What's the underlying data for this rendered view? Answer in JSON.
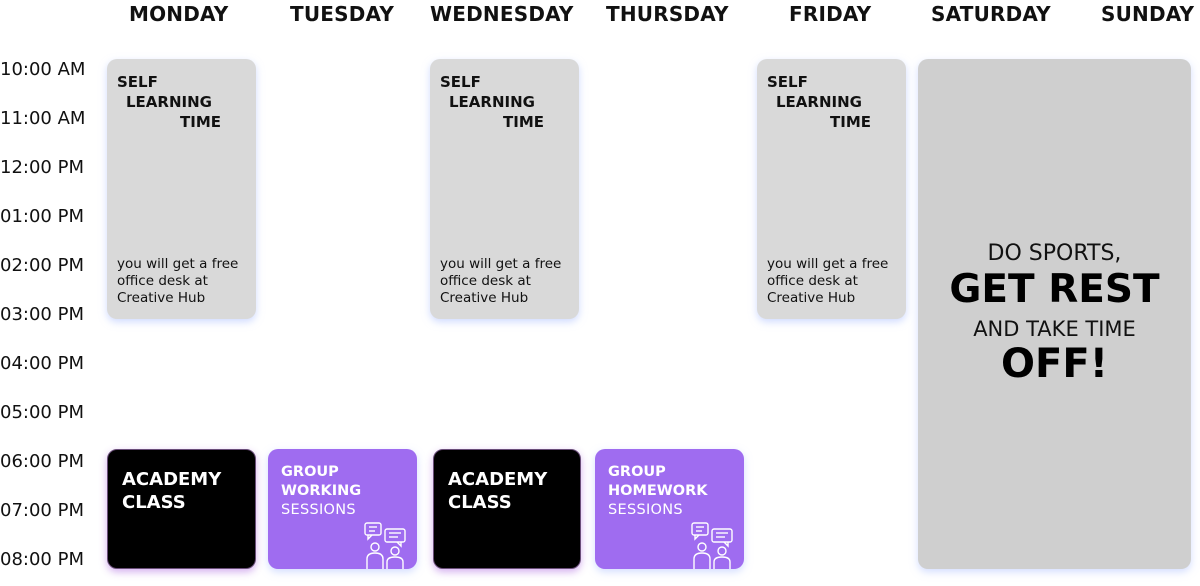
{
  "days": [
    "MONDAY",
    "TUESDAY",
    "WEDNESDAY",
    "THURSDAY",
    "FRIDAY",
    "SATURDAY",
    "SUNDAY"
  ],
  "times": [
    "10:00 AM",
    "11:00 AM",
    "12:00 PM",
    "01:00 PM",
    "02:00 PM",
    "03:00 PM",
    "04:00 PM",
    "05:00 PM",
    "06:00 PM",
    "07:00 PM",
    "08:00 PM"
  ],
  "self_learning": {
    "line1": "SELF",
    "line2": "LEARNING",
    "line3": "TIME",
    "note": "you will get a free office desk at Creative Hub"
  },
  "academy": {
    "line1": "ACADEMY",
    "line2": "CLASS"
  },
  "group_working": {
    "line1": "GROUP",
    "line2": "WORKING",
    "line3": "SESSIONS"
  },
  "group_homework": {
    "line1": "GROUP",
    "line2": "HOMEWORK",
    "line3": "SESSIONS"
  },
  "weekend": {
    "line1": "DO SPORTS,",
    "line2": "GET REST",
    "line3": "AND TAKE TIME",
    "line4": "OFF!"
  },
  "colors": {
    "self_learning_bg": "#d9d9d9",
    "academy_bg": "#000000",
    "group_bg": "#9f6cf0",
    "weekend_bg": "#cfcfcf"
  },
  "icons": {
    "group_sessions": "people-discussion-icon"
  }
}
